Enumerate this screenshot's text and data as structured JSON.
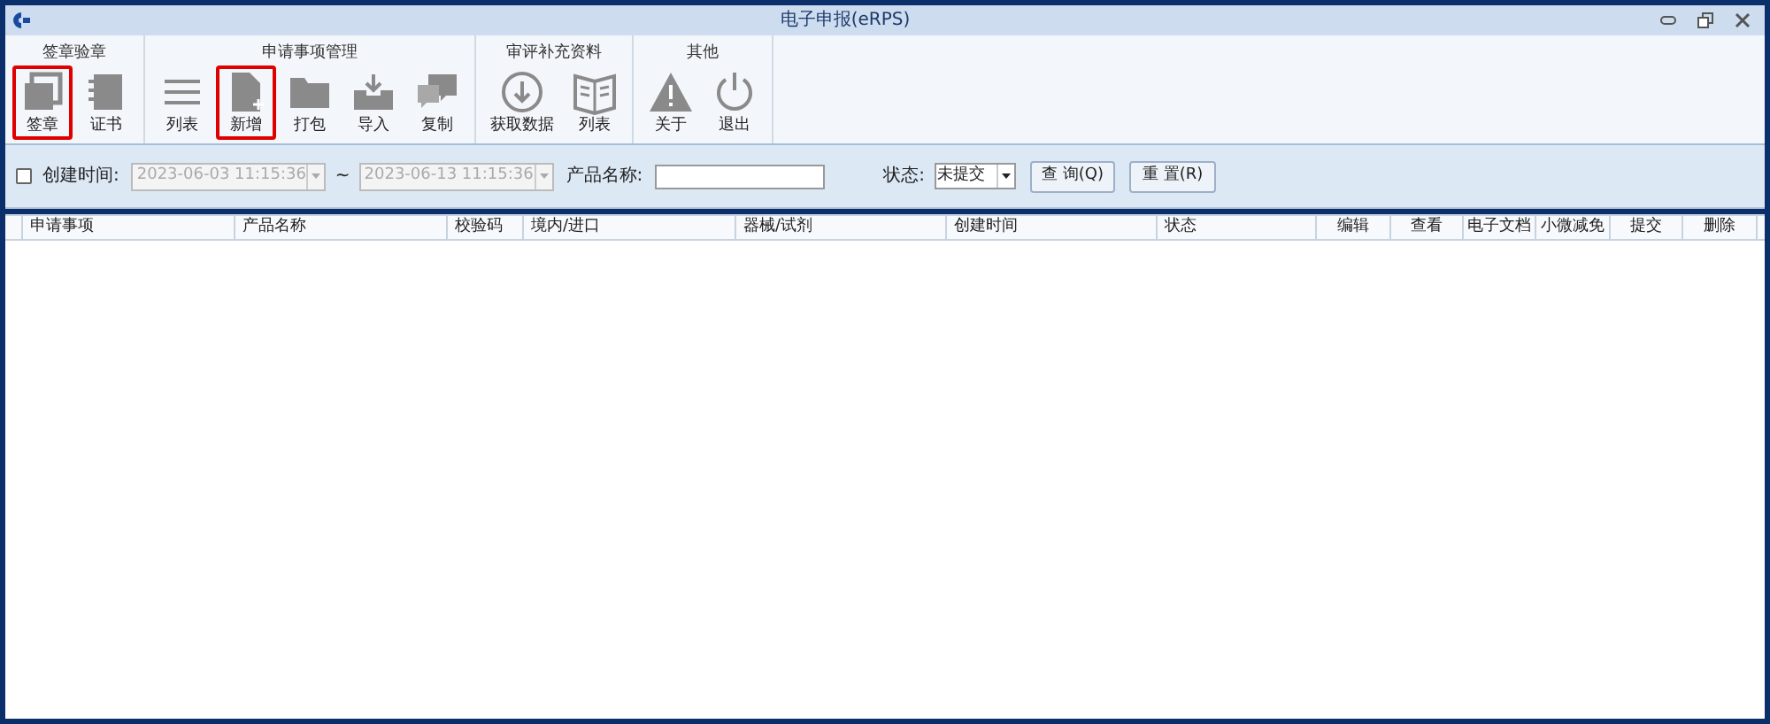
{
  "window": {
    "title": "电子申报(eRPS)"
  },
  "ribbon": [
    {
      "label": "签章验章",
      "buttons": [
        {
          "label": "签章",
          "highlighted": true
        },
        {
          "label": "证书",
          "highlighted": false
        }
      ]
    },
    {
      "label": "申请事项管理",
      "buttons": [
        {
          "label": "列表",
          "highlighted": false
        },
        {
          "label": "新增",
          "highlighted": true
        },
        {
          "label": "打包",
          "highlighted": false
        },
        {
          "label": "导入",
          "highlighted": false
        },
        {
          "label": "复制",
          "highlighted": false
        }
      ]
    },
    {
      "label": "审评补充资料",
      "buttons": [
        {
          "label": "获取数据",
          "highlighted": false
        },
        {
          "label": "列表",
          "highlighted": false
        }
      ]
    },
    {
      "label": "其他",
      "buttons": [
        {
          "label": "关于",
          "highlighted": false
        },
        {
          "label": "退出",
          "highlighted": false
        }
      ]
    }
  ],
  "filter": {
    "created_checkbox": {
      "label": "创建时间:",
      "checked": false
    },
    "date_from": "2023-06-03 11:15:36",
    "separator": "~",
    "date_to": "2023-06-13 11:15:36",
    "product_label": "产品名称:",
    "status_label": "状态:",
    "status_value": "未提交",
    "buttons": [
      "查 询(Q)",
      "重 置(R)"
    ]
  },
  "table": {
    "columns": [
      "申请事项",
      "产品名称",
      "校验码",
      "境内/进口",
      "器械/试剂",
      "创建时间",
      "状态",
      "编辑",
      "查看",
      "电子文档",
      "小微减免",
      "提交",
      "删除"
    ]
  }
}
